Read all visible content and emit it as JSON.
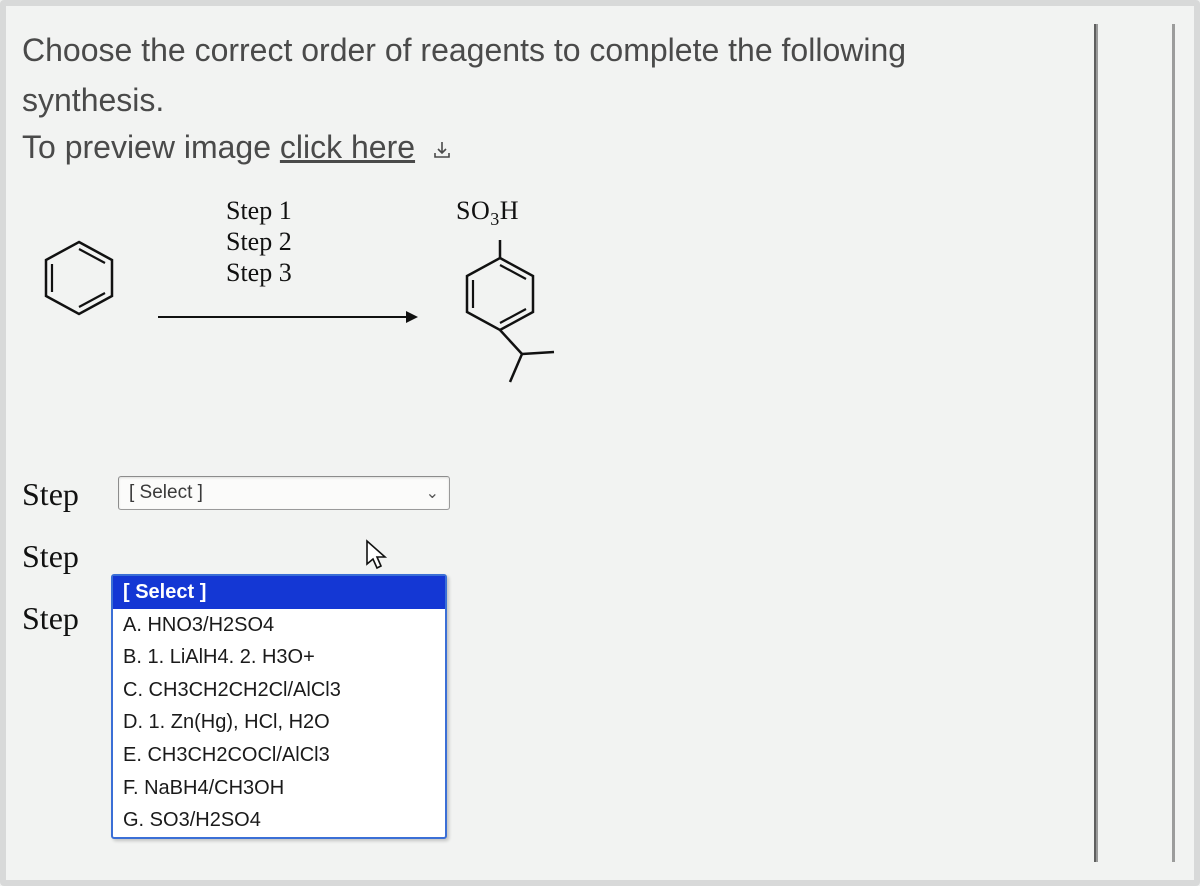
{
  "question": {
    "line1": "Choose the correct order of reagents to complete the following",
    "line2": "synthesis.",
    "preview_prefix": "To preview image ",
    "preview_link": "click here"
  },
  "scheme": {
    "step1": "Step 1",
    "step2": "Step 2",
    "step3": "Step 3",
    "product_label": "SO",
    "product_sub": "3",
    "product_suffix": "H"
  },
  "rows": {
    "label": "Step",
    "selected_text": "[ Select ]"
  },
  "options": [
    "[ Select ]",
    "A. HNO3/H2SO4",
    "B. 1. LiAlH4. 2. H3O+",
    "C. CH3CH2CH2Cl/AlCl3",
    "D. 1. Zn(Hg), HCl, H2O",
    "E. CH3CH2COCl/AlCl3",
    "F. NaBH4/CH3OH",
    "G. SO3/H2SO4"
  ]
}
